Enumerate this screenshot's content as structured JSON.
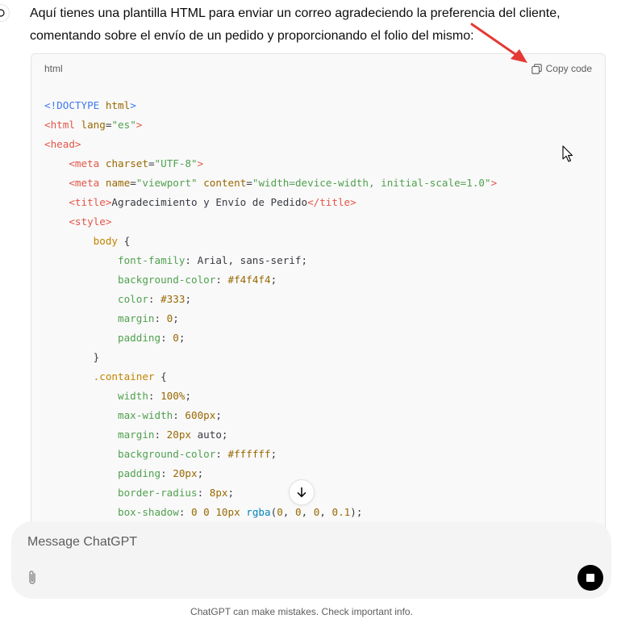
{
  "assistant": {
    "intro_line1": "Aquí tienes una plantilla HTML para enviar un correo agradeciendo la preferencia del cliente,",
    "intro_line2": "comentando sobre el envío de un pedido y proporcionando el folio del mismo:"
  },
  "code_block": {
    "language": "html",
    "copy_label": "Copy code"
  },
  "composer": {
    "placeholder": "Message ChatGPT"
  },
  "footer": {
    "disclaimer": "ChatGPT can make mistakes. Check important info."
  },
  "colors": {
    "annotation_arrow": "#e53935",
    "stop_button": "#000000"
  },
  "icons": [
    "assistant-avatar-icon",
    "copy-icon",
    "arrow-down-icon",
    "paperclip-icon",
    "stop-icon",
    "mouse-cursor-icon"
  ]
}
